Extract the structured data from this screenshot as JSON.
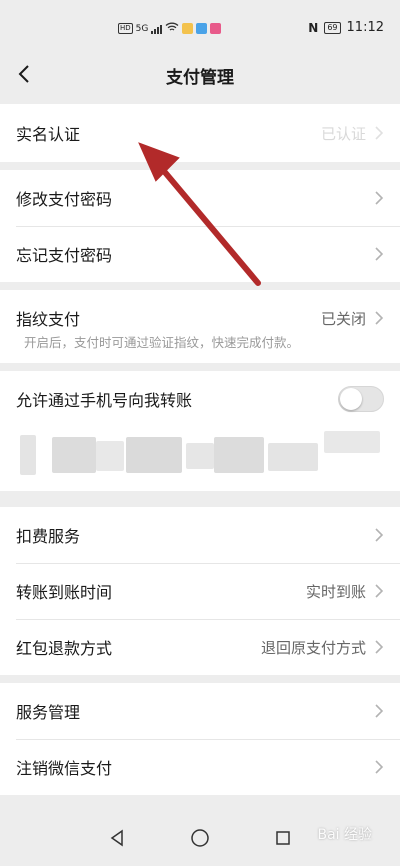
{
  "status_bar": {
    "left_badge": "HD",
    "network": "5G",
    "nfc": "N",
    "battery": "69",
    "time": "11:12"
  },
  "header": {
    "title": "支付管理"
  },
  "sections": {
    "realname": {
      "label": "实名认证",
      "value": "已认证"
    },
    "change_pwd": {
      "label": "修改支付密码"
    },
    "forgot_pwd": {
      "label": "忘记支付密码"
    },
    "fingerprint": {
      "label": "指纹支付",
      "value": "已关闭",
      "desc": "开启后，支付时可通过验证指纹，快速完成付款。"
    },
    "phone_transfer": {
      "label": "允许通过手机号向我转账",
      "enabled": false
    },
    "deduction": {
      "label": "扣费服务"
    },
    "arrival_time": {
      "label": "转账到账时间",
      "value": "实时到账"
    },
    "refund": {
      "label": "红包退款方式",
      "value": "退回原支付方式"
    },
    "service_mgmt": {
      "label": "服务管理"
    },
    "cancel_pay": {
      "label": "注销微信支付"
    }
  },
  "watermark": "Bai 经验",
  "colors": {
    "annotation_arrow": "#b22a2a",
    "background": "#ededed"
  }
}
